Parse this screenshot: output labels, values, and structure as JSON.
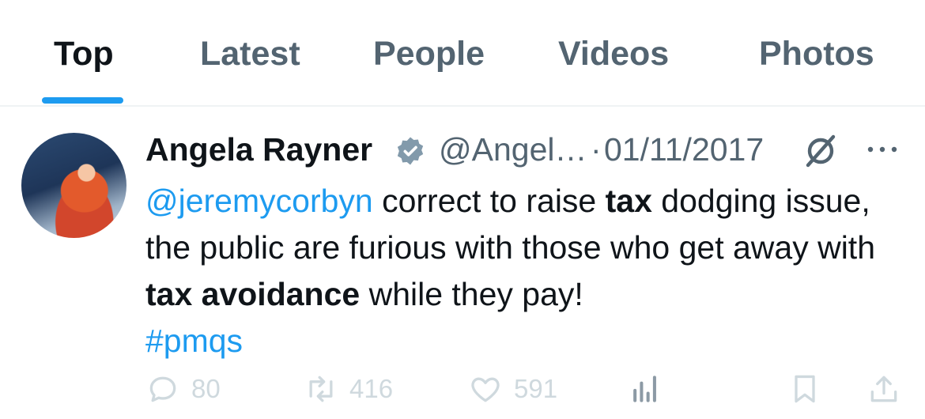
{
  "tabs": [
    {
      "label": "Top",
      "active": true
    },
    {
      "label": "Latest",
      "active": false
    },
    {
      "label": "People",
      "active": false
    },
    {
      "label": "Videos",
      "active": false
    },
    {
      "label": "Photos",
      "active": false
    }
  ],
  "tweet": {
    "author_name": "Angela Rayner",
    "handle": "@Angel…",
    "separator": "·",
    "date": "01/11/2017",
    "text": {
      "mention": "@jeremycorbyn",
      "seg1": " correct to raise ",
      "bold1": "tax",
      "seg2": " dodging issue, the public are furious with those who get away with ",
      "bold2": "tax avoidance",
      "seg3": " while they pay!",
      "hashtag": "#pmqs"
    },
    "stats": {
      "replies": "80",
      "retweets": "416",
      "likes": "591"
    }
  },
  "colors": {
    "accent": "#1d9bf0",
    "muted": "#536471",
    "text": "#0f1419",
    "divider": "#eff3f4"
  },
  "icons": [
    "verified-badge-icon",
    "grok-icon",
    "more-icon",
    "reply-icon",
    "retweet-icon",
    "like-icon",
    "views-icon",
    "bookmark-icon",
    "share-icon"
  ]
}
